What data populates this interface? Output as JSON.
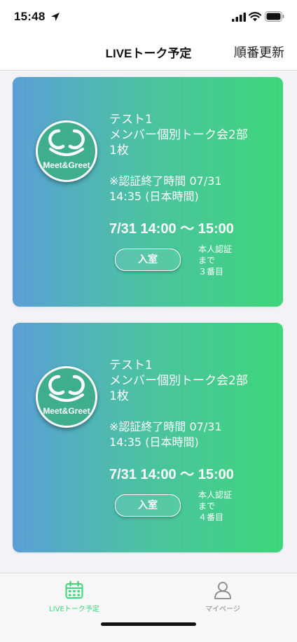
{
  "status_bar": {
    "time": "15:48"
  },
  "nav": {
    "title": "LIVEトーク予定",
    "action_label": "順番更新"
  },
  "cards": [
    {
      "logo_text": "Meet&Greet",
      "title": "テスト1",
      "subtitle": "メンバー個別トーク会2部",
      "count": "1枚",
      "notice_line1": "※認証終了時間 07/31",
      "notice_line2": "14:35 (日本時間)",
      "time_range": "7/31 14:00 〜 15:00",
      "enter_label": "入室",
      "queue_line1": "本人認証",
      "queue_line2": "まで",
      "queue_line3": "３番目"
    },
    {
      "logo_text": "Meet&Greet",
      "title": "テスト1",
      "subtitle": "メンバー個別トーク会2部",
      "count": "1枚",
      "notice_line1": "※認証終了時間 07/31",
      "notice_line2": "14:35 (日本時間)",
      "time_range": "7/31 14:00 〜 15:00",
      "enter_label": "入室",
      "queue_line1": "本人認証",
      "queue_line2": "まで",
      "queue_line3": "４番目"
    }
  ],
  "tabs": [
    {
      "label": "LIVEトーク予定",
      "icon": "calendar-icon",
      "active": true
    },
    {
      "label": "マイページ",
      "icon": "person-icon",
      "active": false
    }
  ],
  "colors": {
    "accent": "#3ed679",
    "gradient_start": "#5a9fd6",
    "gradient_end": "#3ed679",
    "inactive": "#888888"
  }
}
